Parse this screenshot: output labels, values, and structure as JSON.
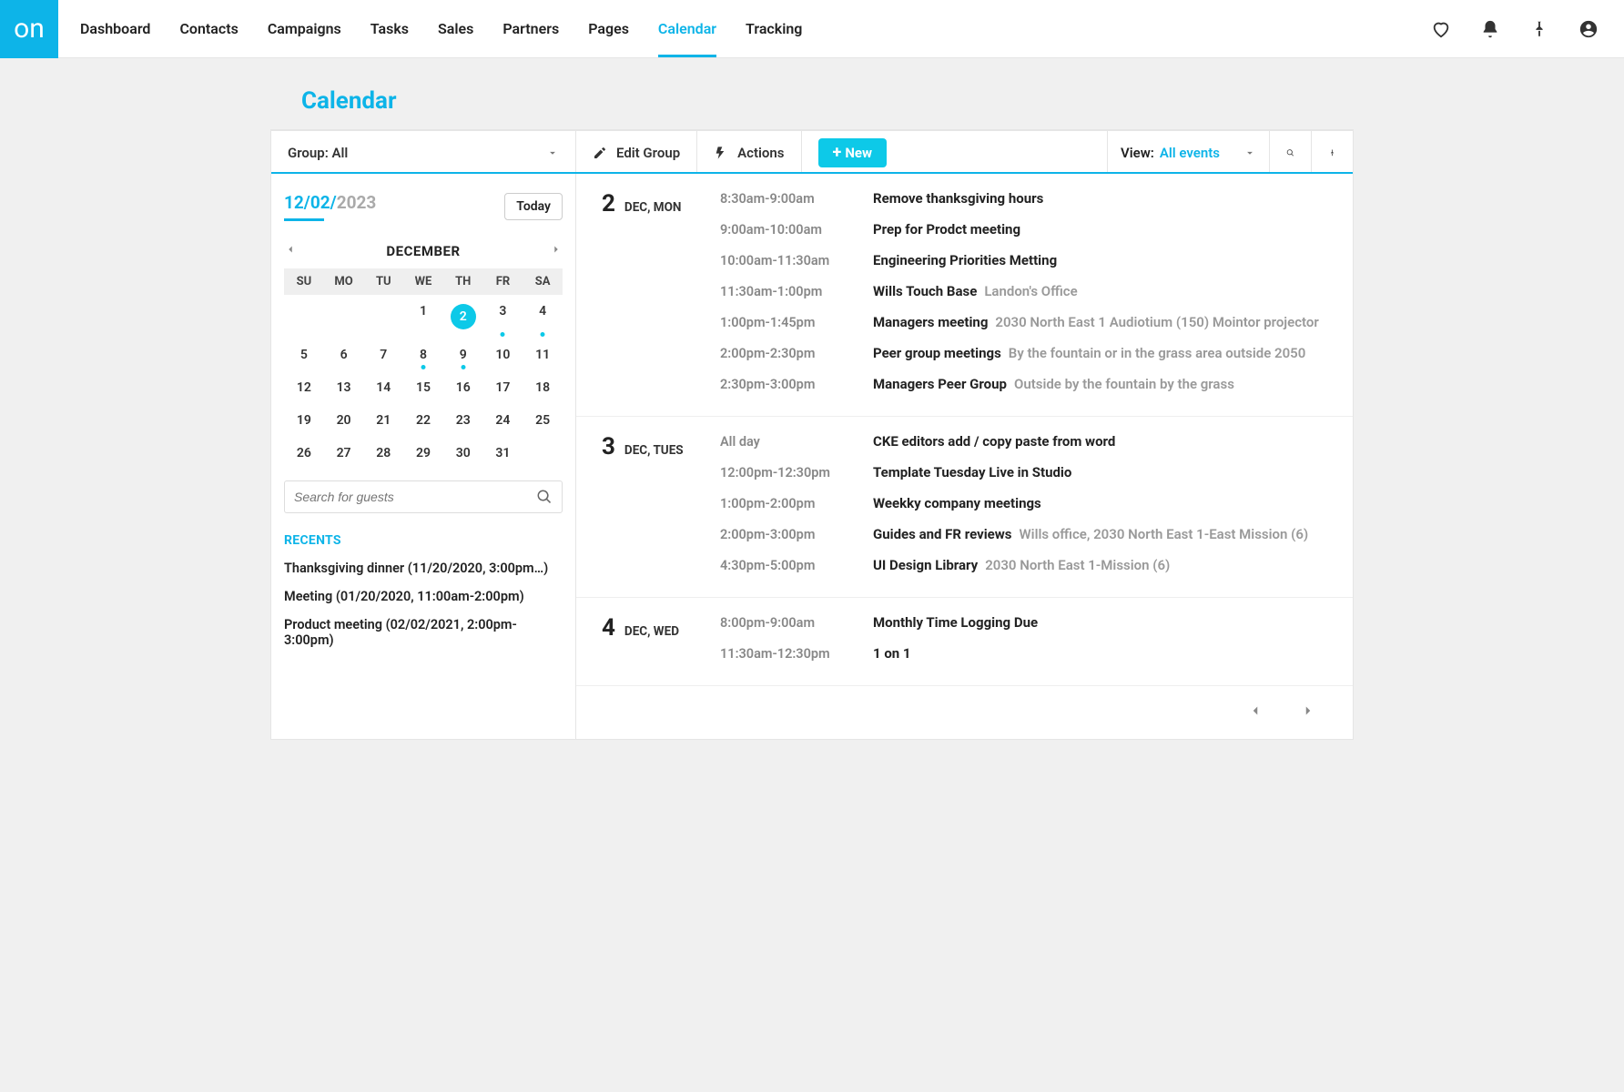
{
  "logo": "on",
  "nav": [
    "Dashboard",
    "Contacts",
    "Campaigns",
    "Tasks",
    "Sales",
    "Partners",
    "Pages",
    "Calendar",
    "Tracking"
  ],
  "nav_active": "Calendar",
  "page_title": "Calendar",
  "toolbar": {
    "group_label": "Group: All",
    "edit_group": "Edit Group",
    "actions": "Actions",
    "new": "New",
    "view_label": "View:",
    "view_value": "All events"
  },
  "date_picker": {
    "active": "12/02/",
    "year": "2023",
    "today": "Today",
    "month": "DECEMBER",
    "weekdays": [
      "SU",
      "MO",
      "TU",
      "WE",
      "TH",
      "FR",
      "SA"
    ],
    "weeks": [
      [
        "",
        "",
        "",
        "1",
        "2",
        "3",
        "4"
      ],
      [
        "5",
        "6",
        "7",
        "8",
        "9",
        "10",
        "11"
      ],
      [
        "12",
        "13",
        "14",
        "15",
        "16",
        "17",
        "18"
      ],
      [
        "19",
        "20",
        "21",
        "22",
        "23",
        "24",
        "25"
      ],
      [
        "26",
        "27",
        "28",
        "29",
        "30",
        "31",
        ""
      ]
    ],
    "selected": "2",
    "dots": [
      "3",
      "4",
      "8",
      "9"
    ]
  },
  "search_placeholder": "Search for guests",
  "recents_header": "RECENTS",
  "recents": [
    "Thanksgiving dinner (11/20/2020, 3:00pm…)",
    "Meeting (01/20/2020, 11:00am-2:00pm)",
    "Product meeting (02/02/2021, 2:00pm-3:00pm)"
  ],
  "days": [
    {
      "num": "2",
      "label": "DEC, MON",
      "events": [
        {
          "time": "8:30am-9:00am",
          "title": "Remove thanksgiving hours",
          "loc": ""
        },
        {
          "time": "9:00am-10:00am",
          "title": "Prep for Prodct meeting",
          "loc": ""
        },
        {
          "time": "10:00am-11:30am",
          "title": "Engineering Priorities Metting",
          "loc": ""
        },
        {
          "time": "11:30am-1:00pm",
          "title": "Wills Touch Base",
          "loc": "Landon's Office"
        },
        {
          "time": "1:00pm-1:45pm",
          "title": "Managers meeting",
          "loc": "2030 North East 1 Audiotium (150) Mointor projector"
        },
        {
          "time": "2:00pm-2:30pm",
          "title": "Peer group meetings",
          "loc": "By the fountain or in the grass area outside 2050"
        },
        {
          "time": "2:30pm-3:00pm",
          "title": "Managers Peer Group",
          "loc": "Outside by the fountain by the grass"
        }
      ]
    },
    {
      "num": "3",
      "label": "DEC, TUES",
      "events": [
        {
          "time": "All day",
          "title": "CKE editors add / copy paste from word",
          "loc": ""
        },
        {
          "time": "12:00pm-12:30pm",
          "title": "Template Tuesday Live in Studio",
          "loc": ""
        },
        {
          "time": "1:00pm-2:00pm",
          "title": "Weekky company meetings",
          "loc": ""
        },
        {
          "time": "2:00pm-3:00pm",
          "title": "Guides and FR reviews",
          "loc": "Wills office, 2030 North East 1-East Mission (6)"
        },
        {
          "time": "4:30pm-5:00pm",
          "title": "UI Design Library",
          "loc": "2030 North East 1-Mission (6)"
        }
      ]
    },
    {
      "num": "4",
      "label": "DEC, WED",
      "events": [
        {
          "time": "8:00pm-9:00am",
          "title": "Monthly Time Logging Due",
          "loc": ""
        },
        {
          "time": "11:30am-12:30pm",
          "title": "1 on 1",
          "loc": ""
        }
      ]
    }
  ]
}
